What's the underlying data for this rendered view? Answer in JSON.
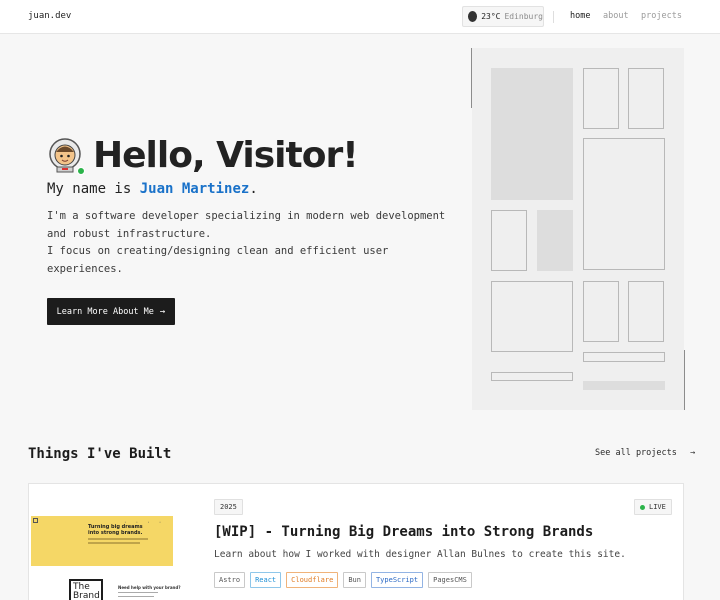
{
  "header": {
    "brand": "juan.dev",
    "weather": {
      "temp": "23°C",
      "city": "Edinburg"
    },
    "nav": [
      {
        "label": "home",
        "active": true
      },
      {
        "label": "about",
        "active": false
      },
      {
        "label": "projects",
        "active": false
      }
    ]
  },
  "hero": {
    "greeting": "Hello, Visitor!",
    "intro_prefix": "My name is",
    "name": "Juan Martinez",
    "intro_suffix": ".",
    "bio_lines": [
      "I'm a software developer specializing in modern web development",
      "and robust infrastructure.",
      "I focus on creating/designing clean and efficient user",
      "experiences."
    ],
    "cta_label": "Learn More About Me",
    "cta_icon": "arrow-right-icon",
    "avatar_icon": "astronaut-avatar-icon"
  },
  "built": {
    "title": "Things I've Built",
    "see_all": "See all projects",
    "see_all_icon": "arrow-right-icon"
  },
  "project": {
    "year": "2025",
    "status": "LIVE",
    "title": "[WIP] - Turning Big Dreams into Strong Brands",
    "description": "Learn about how I worked with designer Allan Bulnes to create this site.",
    "tags": [
      "Astro",
      "React",
      "Cloudflare",
      "Bun",
      "TypeScript",
      "PagesCMS"
    ],
    "thumbnail": {
      "headline": "Turning big dreams into strong brands.",
      "logo_text": "The Brand",
      "help_text": "Need help with your brand?"
    }
  },
  "colors": {
    "accent_name": "#1a72c9",
    "live_dot": "#2bb34a",
    "thumb_yellow": "#f5d766",
    "button_bg": "#1c1c1c"
  }
}
